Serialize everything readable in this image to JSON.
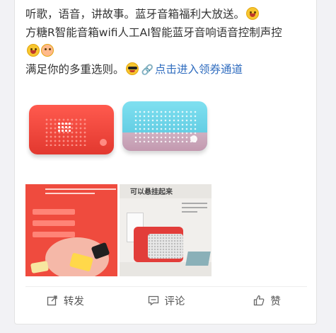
{
  "post": {
    "line1": "听歌，语音，讲故事。蓝牙音箱福利大放送。",
    "line2": "方糖R智能音箱wifi人工AI智能蓝牙音响语音控制声控",
    "line3": "满足你的多重选则。",
    "link_text": "点击进入领券通道"
  },
  "thumbnails": [
    {
      "name": "red speaker product photo"
    },
    {
      "title": "可以悬挂起来"
    }
  ],
  "actions": {
    "repost_label": "转发",
    "comment_label": "评论",
    "like_label": "赞"
  },
  "colors": {
    "link": "#2f6cbf",
    "text": "#333333",
    "action_text": "#555555"
  },
  "icons": [
    "grin-emoji-icon",
    "laugh-emoji-icon",
    "blush-emoji-icon",
    "sunglasses-emoji-icon",
    "link-icon",
    "repost-icon",
    "comment-icon",
    "like-icon"
  ]
}
